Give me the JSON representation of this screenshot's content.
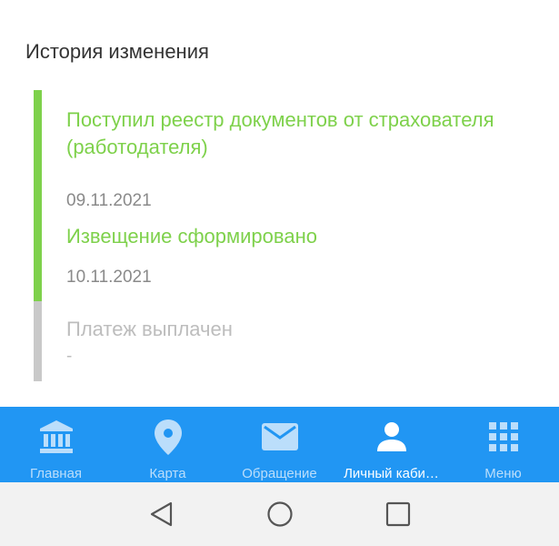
{
  "history": {
    "title": "История изменения",
    "events": [
      {
        "title": "Поступил реестр документов от страхователя (работодателя)",
        "date": "09.11.2021",
        "status": "done"
      },
      {
        "title": "Извещение сформировано",
        "date": "10.11.2021",
        "status": "done"
      },
      {
        "title": "Платеж выплачен",
        "date": "-",
        "status": "pending"
      }
    ]
  },
  "bottom_nav": {
    "items": [
      {
        "label": "Главная",
        "icon": "bank-icon"
      },
      {
        "label": "Карта",
        "icon": "location-pin-icon"
      },
      {
        "label": "Обращение",
        "icon": "envelope-icon"
      },
      {
        "label": "Личный каби…",
        "icon": "person-icon",
        "active": true
      },
      {
        "label": "Меню",
        "icon": "grid-icon"
      }
    ]
  },
  "colors": {
    "accent_green": "#7ED14B",
    "nav_blue": "#2196F3",
    "pending_gray": "#BDBDBD"
  }
}
